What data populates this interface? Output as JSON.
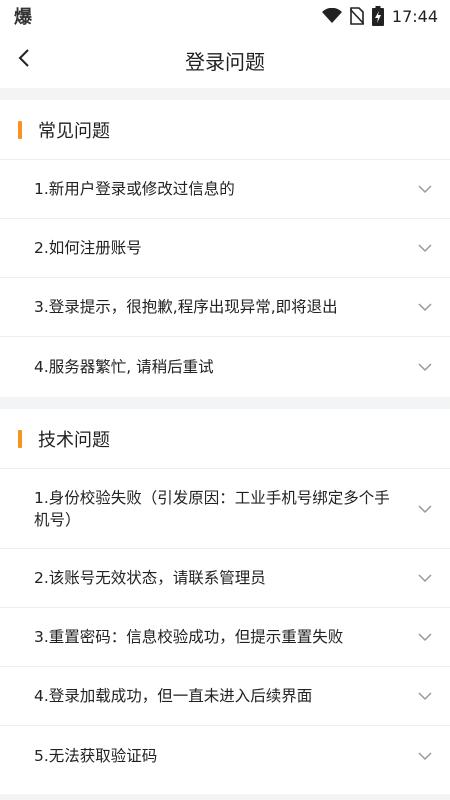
{
  "status_bar": {
    "left_glyph": "爆",
    "time": "17:44"
  },
  "nav": {
    "title": "登录问题"
  },
  "sections": [
    {
      "title": "常见问题",
      "items": [
        {
          "label": "1.新用户登录或修改过信息的"
        },
        {
          "label": "2.如何注册账号"
        },
        {
          "label": "3.登录提示，很抱歉,程序出现异常,即将退出"
        },
        {
          "label": "4.服务器繁忙, 请稍后重试"
        }
      ]
    },
    {
      "title": "技术问题",
      "items": [
        {
          "label": "1.身份校验失败（引发原因：工业手机号绑定多个手机号）"
        },
        {
          "label": "2.该账号无效状态，请联系管理员"
        },
        {
          "label": "3.重置密码：信息校验成功，但提示重置失败"
        },
        {
          "label": "4.登录加载成功，但一直未进入后续界面"
        },
        {
          "label": "5.无法获取验证码"
        }
      ]
    }
  ],
  "colors": {
    "accent": "#f7931e",
    "background": "#f3f4f6",
    "surface": "#ffffff"
  }
}
